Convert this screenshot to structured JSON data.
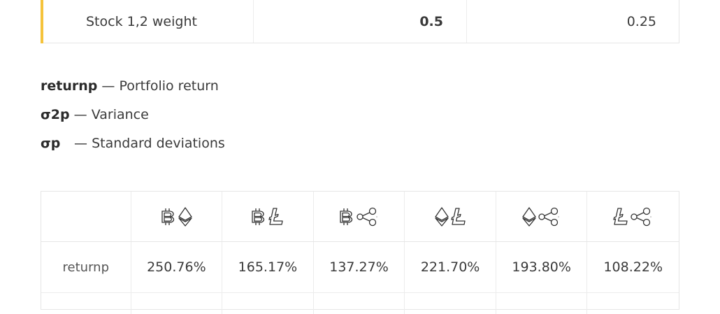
{
  "weights_row": {
    "label": "Stock 1,2 weight",
    "value_a": "0.5",
    "value_b": "0.25"
  },
  "definitions": [
    {
      "term": "returnp",
      "sep": " — ",
      "desc": "Portfolio return"
    },
    {
      "term": "σ2p",
      "sep": " — ",
      "desc": "Variance"
    },
    {
      "term": "σp",
      "sep": " — ",
      "desc": "Standard deviations"
    }
  ],
  "pair_table": {
    "columns": [
      {
        "icons": [
          "bitcoin-icon",
          "ethereum-icon"
        ]
      },
      {
        "icons": [
          "bitcoin-icon",
          "litecoin-icon"
        ]
      },
      {
        "icons": [
          "bitcoin-icon",
          "ripple-icon"
        ]
      },
      {
        "icons": [
          "ethereum-icon",
          "litecoin-icon"
        ]
      },
      {
        "icons": [
          "ethereum-icon",
          "ripple-icon"
        ]
      },
      {
        "icons": [
          "litecoin-icon",
          "ripple-icon"
        ]
      }
    ],
    "rows": [
      {
        "label": "returnp",
        "values": [
          "250.76%",
          "165.17%",
          "137.27%",
          "221.70%",
          "193.80%",
          "108.22%"
        ]
      }
    ]
  },
  "colors": {
    "accent": "#f5c33b",
    "border": "#e6e6e6",
    "text": "#3a3a3a",
    "icon_stroke": "#333333"
  }
}
